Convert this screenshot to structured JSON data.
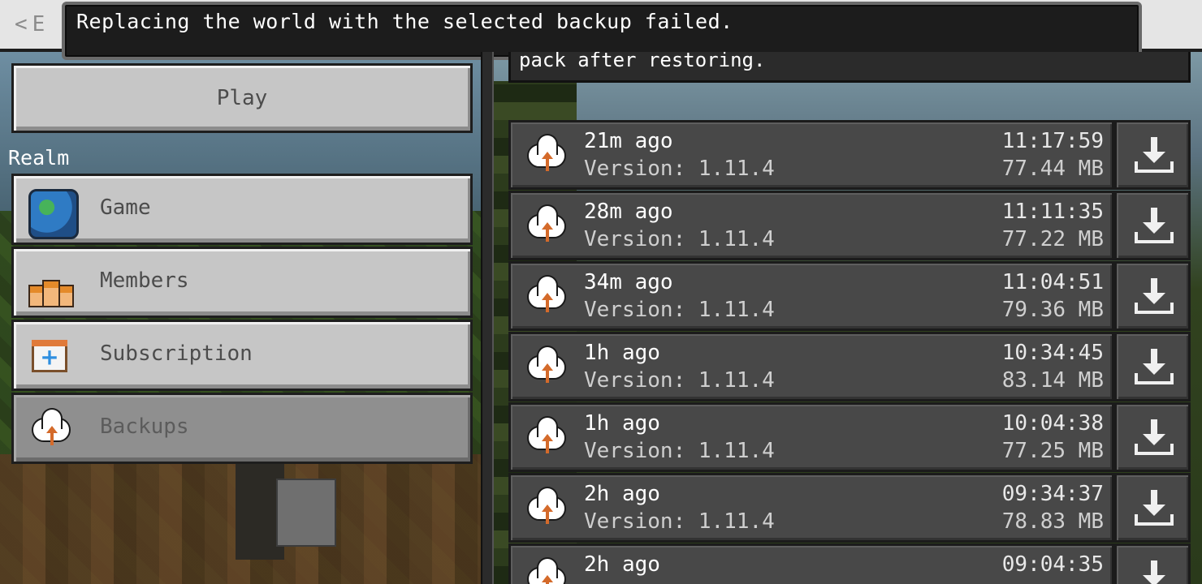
{
  "header": {
    "back_label": "E",
    "back_chevron": "<"
  },
  "toast": {
    "message": "Replacing the world with the selected backup failed."
  },
  "info_text": "pack after restoring.",
  "left": {
    "play_label": "Play",
    "section_label": "Realm",
    "nav": [
      {
        "label": "Game",
        "icon": "globe-icon"
      },
      {
        "label": "Members",
        "icon": "members-icon"
      },
      {
        "label": "Subscription",
        "icon": "subscription-icon"
      },
      {
        "label": "Backups",
        "icon": "cloud-upload-icon",
        "active": true
      }
    ]
  },
  "backups": [
    {
      "ago": "21m ago",
      "version": "Version: 1.11.4",
      "time": "11:17:59",
      "size": "77.44 MB"
    },
    {
      "ago": "28m ago",
      "version": "Version: 1.11.4",
      "time": "11:11:35",
      "size": "77.22 MB"
    },
    {
      "ago": "34m ago",
      "version": "Version: 1.11.4",
      "time": "11:04:51",
      "size": "79.36 MB"
    },
    {
      "ago": "1h ago",
      "version": "Version: 1.11.4",
      "time": "10:34:45",
      "size": "83.14 MB"
    },
    {
      "ago": "1h ago",
      "version": "Version: 1.11.4",
      "time": "10:04:38",
      "size": "77.25 MB"
    },
    {
      "ago": "2h ago",
      "version": "Version: 1.11.4",
      "time": "09:34:37",
      "size": "78.83 MB"
    },
    {
      "ago": "2h ago",
      "version": "",
      "time": "09:04:35",
      "size": ""
    }
  ],
  "colors": {
    "toast_bg": "#1c1c1c",
    "button_gray": "#c6c6c6",
    "row_bg": "#484848",
    "arrow_orange": "#d46a2a"
  }
}
